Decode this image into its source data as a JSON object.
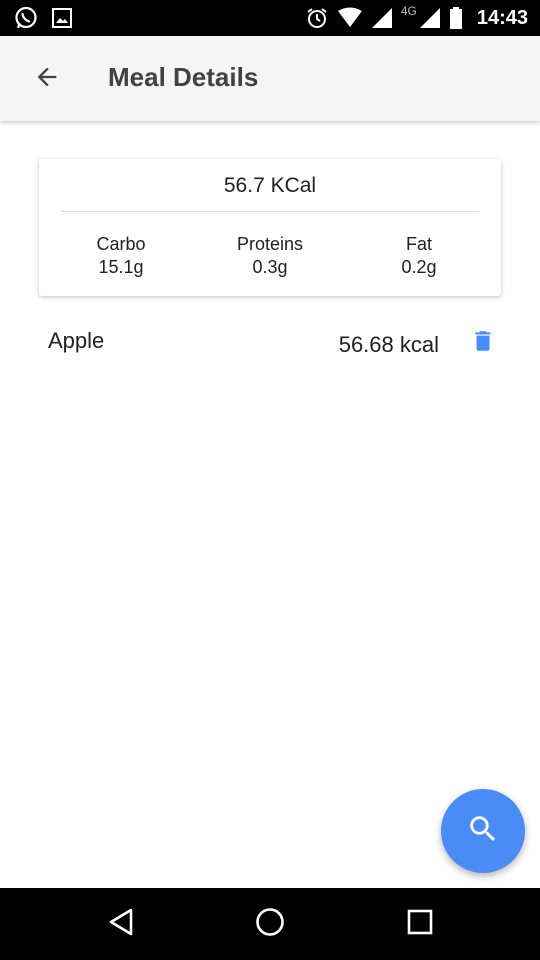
{
  "status_bar": {
    "time": "14:43",
    "network_type": "4G",
    "icons": [
      "whatsapp-icon",
      "image-icon",
      "alarm-icon",
      "wifi-icon",
      "signal-icon",
      "signal-icon",
      "battery-icon"
    ]
  },
  "app_bar": {
    "title": "Meal Details",
    "back_icon": "arrow-back-icon"
  },
  "summary": {
    "total": "56.7 KCal",
    "macros": [
      {
        "label": "Carbo",
        "value": "15.1g"
      },
      {
        "label": "Proteins",
        "value": "0.3g"
      },
      {
        "label": "Fat",
        "value": "0.2g"
      }
    ]
  },
  "foods": [
    {
      "name": "Apple",
      "kcal": "56.68 kcal",
      "action_icon": "delete-icon"
    }
  ],
  "fab": {
    "icon": "search-icon"
  },
  "nav_bar": {
    "icons": [
      "nav-back-icon",
      "nav-home-icon",
      "nav-recents-icon"
    ]
  },
  "colors": {
    "accent": "#4a8cf5",
    "app_bar_bg": "#f5f5f5",
    "title_text": "#424242",
    "system_bars": "#000000"
  }
}
